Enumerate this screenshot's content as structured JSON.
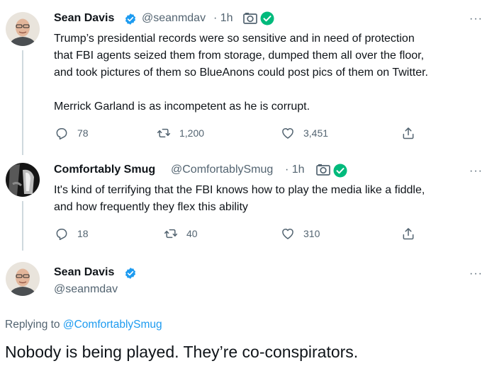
{
  "tweets": [
    {
      "name": "Sean Davis",
      "handle": "@seanmdav",
      "time": "· 1h",
      "lines": [
        "Trump’s presidential records were so sensitive and in need of protection",
        "that FBI agents seized them from storage, dumped them all over the floor,",
        "and took pictures of them so BlueAnons could post pics of them on Twitter.",
        "",
        "Merrick Garland is as incompetent as he is corrupt."
      ],
      "replies": "78",
      "retweets": "1,200",
      "likes": "3,451"
    },
    {
      "name": "Comfortably Smug",
      "handle": "@ComfortablySmug",
      "time": "· 1h",
      "lines": [
        "It's kind of terrifying that the FBI knows how to play the media like a fiddle,",
        "and how frequently they flex this ability"
      ],
      "replies": "18",
      "retweets": "40",
      "likes": "310"
    }
  ],
  "main_tweet": {
    "name": "Sean Davis",
    "handle": "@seanmdav",
    "replying_prefix": "Replying to",
    "replying_to": "@ComfortablySmug",
    "text": "Nobody is being played. They’re co-conspirators."
  },
  "more_label": "···",
  "colors": {
    "verified": "#1d9bf0",
    "affiliate": "#00ba7c",
    "secondary": "#536471"
  }
}
